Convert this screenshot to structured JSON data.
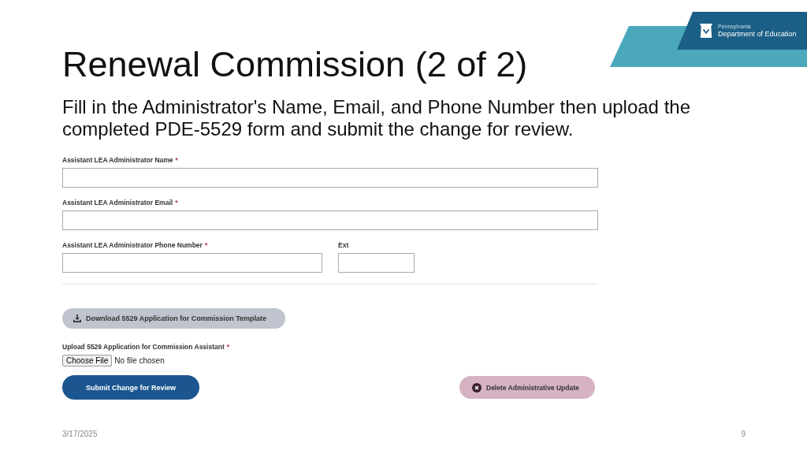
{
  "banner": {
    "small_text": "Pennsylvania",
    "name": "Department of Education"
  },
  "title": "Renewal Commission (2 of 2)",
  "instructions": "Fill in the Administrator's Name, Email, and Phone Number then upload the completed PDE-5529 form and submit the change for review.",
  "form": {
    "rows": [
      [
        {
          "label": "Assistant LEA Administrator Name",
          "marker": "*",
          "kind": "full"
        }
      ],
      [
        {
          "label": "Assistant LEA Administrator Email",
          "marker": "*",
          "kind": "full"
        }
      ],
      [
        {
          "label": "Assistant LEA Administrator Phone Number",
          "marker": "*",
          "kind": "half"
        },
        {
          "label": "Ext",
          "kind": "small"
        }
      ]
    ],
    "download_button": "Download 5529 Application for Commission Template",
    "upload": {
      "label": "Upload 5529 Application for Commission Assistant",
      "marker": "*",
      "button": "Choose File",
      "status": "No file chosen"
    },
    "submit_button": "Submit Change for Review",
    "delete_button": "Delete Administrative Update"
  },
  "footer": {
    "date": "3/17/2025",
    "page": "9"
  }
}
